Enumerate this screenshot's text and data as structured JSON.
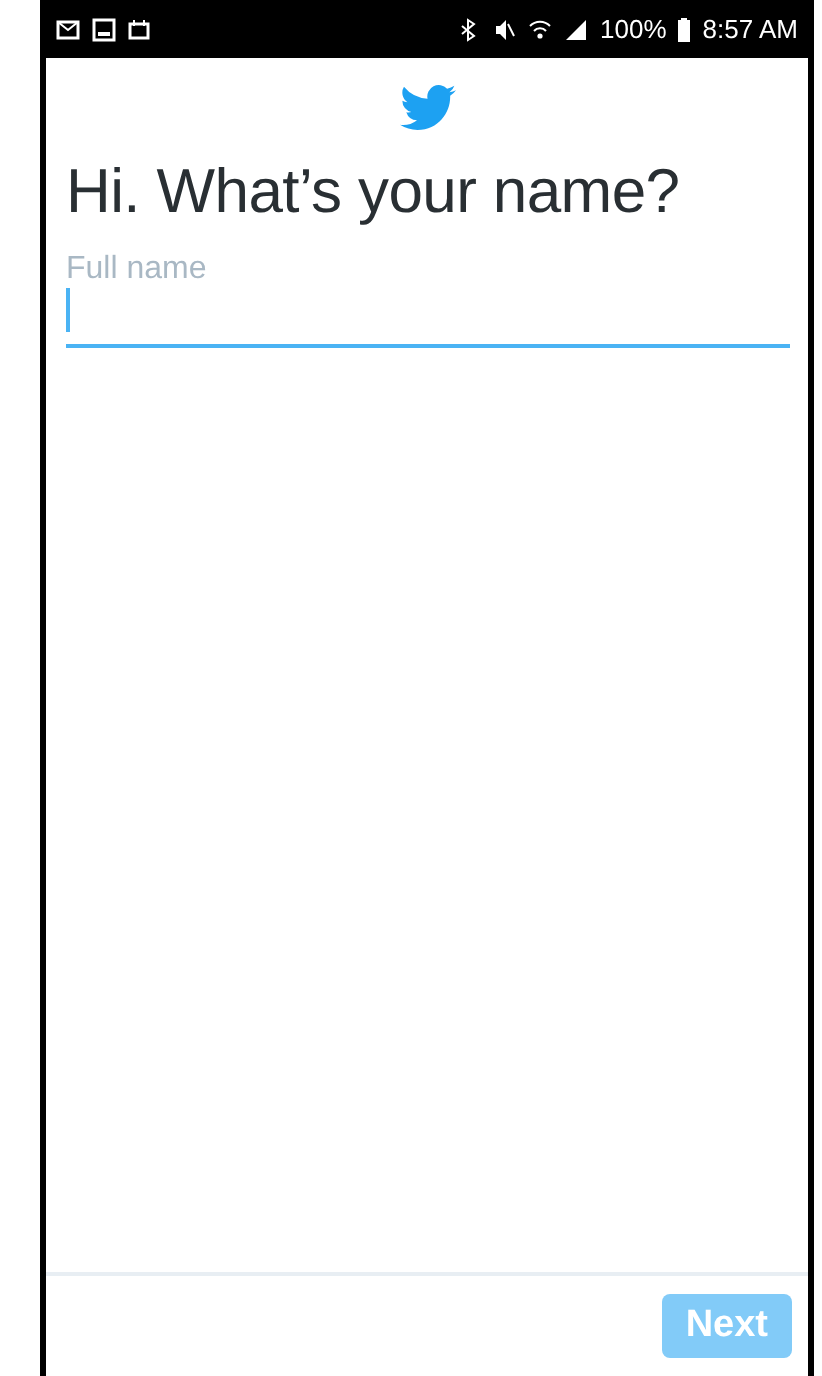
{
  "status_bar": {
    "battery": "100%",
    "time": "8:57 AM"
  },
  "heading": "Hi. What’s your name?",
  "name_field": {
    "placeholder": "Full name",
    "focused": true
  },
  "next_button": {
    "label": "Next",
    "disabled": true
  }
}
